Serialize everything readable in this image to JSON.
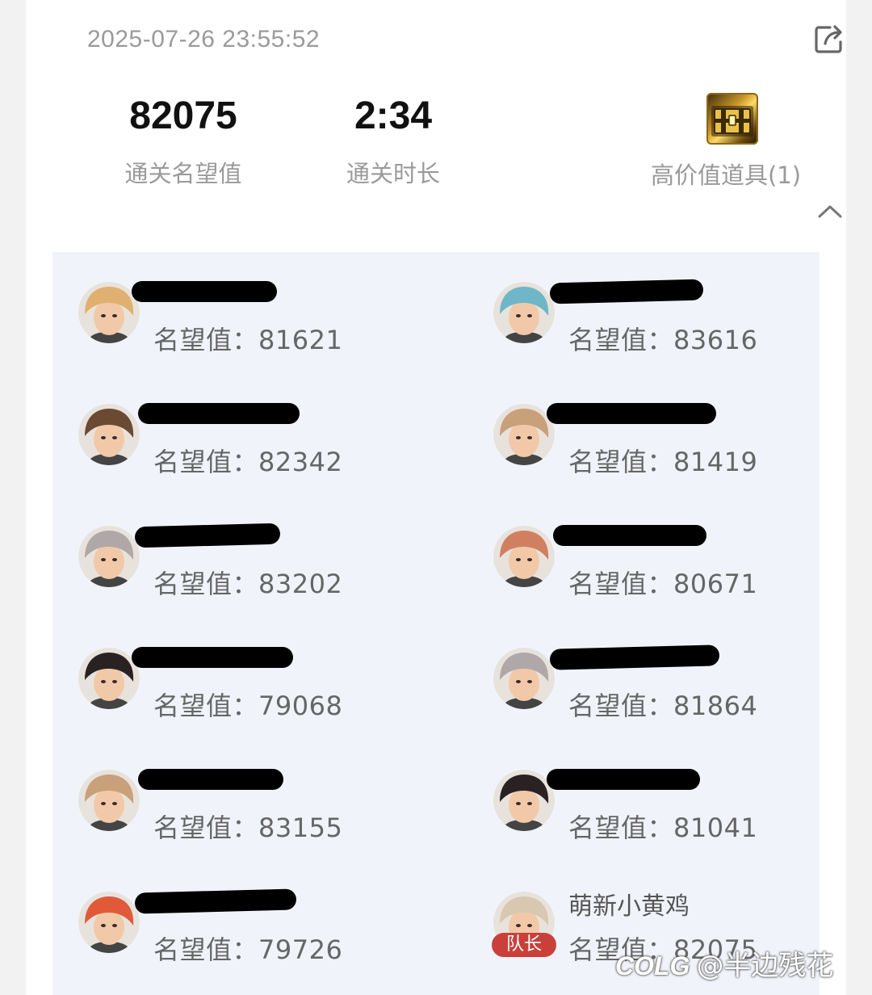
{
  "record": {
    "timestamp": "2025-07-26 23:55:52",
    "fame_value": "82075",
    "fame_label": "通关名望值",
    "clear_time": "2:34",
    "clear_time_label": "通关时长",
    "item_label": "高价值道具(1)"
  },
  "members": [
    {
      "name": "",
      "fame": "名望值：81621",
      "avatar": "avatar-blonde-fighter",
      "hue": "#e0b070"
    },
    {
      "name": "",
      "fame": "名望值：83616",
      "avatar": "avatar-teal-hair-girl",
      "hue": "#6fb6c8"
    },
    {
      "name": "",
      "fame": "名望值：82342",
      "avatar": "avatar-dark-hair-man",
      "hue": "#6a4a32"
    },
    {
      "name": "",
      "fame": "名望值：81419",
      "avatar": "avatar-masked-spiky-hair",
      "hue": "#c8a07a"
    },
    {
      "name": "",
      "fame": "名望值：83202",
      "avatar": "avatar-silver-hair-woman",
      "hue": "#b0a8a8"
    },
    {
      "name": "",
      "fame": "名望值：80671",
      "avatar": "avatar-brown-hair-girl",
      "hue": "#d08060"
    },
    {
      "name": "",
      "fame": "名望值：79068",
      "avatar": "avatar-black-hair-woman",
      "hue": "#2a2222"
    },
    {
      "name": "",
      "fame": "名望值：81864",
      "avatar": "avatar-silver-hair-woman",
      "hue": "#b0a8a8"
    },
    {
      "name": "",
      "fame": "名望值：83155",
      "avatar": "avatar-masked-spiky-hair",
      "hue": "#c8a07a"
    },
    {
      "name": "",
      "fame": "名望值：81041",
      "avatar": "avatar-black-hair-woman",
      "hue": "#2a2222"
    },
    {
      "name": "",
      "fame": "名望值：79726",
      "avatar": "avatar-red-hair-girl",
      "hue": "#e05a3a"
    },
    {
      "name": "萌新小黄鸡",
      "fame": "名望值：82075",
      "avatar": "avatar-goggles-white-hair",
      "hue": "#d8c8b0",
      "badge": "队长"
    }
  ],
  "watermark": {
    "logo": "COLG",
    "handle": "@半边残花"
  },
  "icons": {
    "share": "share-icon",
    "collapse": "chevron-up-icon"
  },
  "colors": {
    "party_bg": "#f0f4fa",
    "leader_badge": "#c9403a",
    "muted_text": "#9a9a9a"
  }
}
